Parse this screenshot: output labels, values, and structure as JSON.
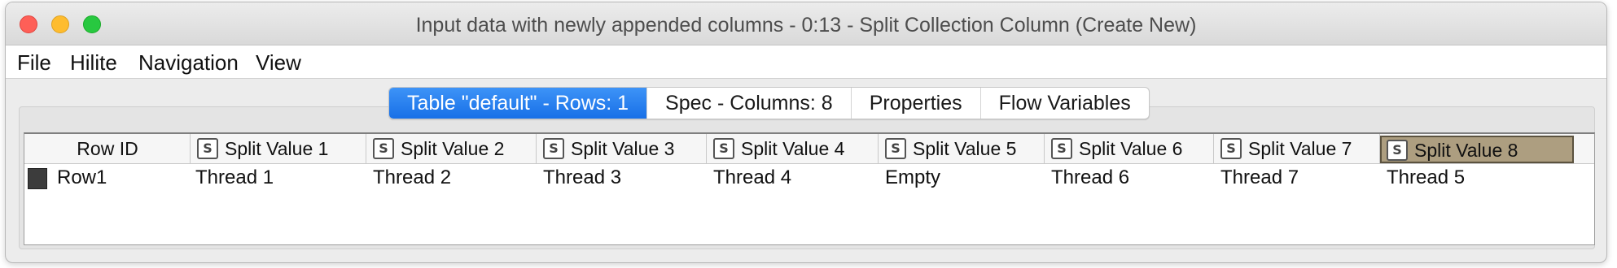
{
  "window": {
    "title": "Input data with newly appended columns - 0:13 - Split Collection Column (Create New)"
  },
  "menu": {
    "items": [
      "File",
      "Hilite",
      "Navigation",
      "View"
    ]
  },
  "tabs": [
    {
      "label": "Table \"default\" - Rows: 1",
      "active": true
    },
    {
      "label": "Spec - Columns: 8",
      "active": false
    },
    {
      "label": "Properties",
      "active": false
    },
    {
      "label": "Flow Variables",
      "active": false
    }
  ],
  "table": {
    "rowid_header": "Row ID",
    "columns": [
      {
        "type_badge": "S",
        "name": "Split Value 1"
      },
      {
        "type_badge": "S",
        "name": "Split Value 2"
      },
      {
        "type_badge": "S",
        "name": "Split Value 3"
      },
      {
        "type_badge": "S",
        "name": "Split Value 4"
      },
      {
        "type_badge": "S",
        "name": "Split Value 5"
      },
      {
        "type_badge": "S",
        "name": "Split Value 6"
      },
      {
        "type_badge": "S",
        "name": "Split Value 7"
      },
      {
        "type_badge": "S",
        "name": "Split Value 8",
        "selected": true
      }
    ],
    "rows": [
      {
        "row_id": "Row1",
        "cells": [
          "Thread 1",
          "Thread 2",
          "Thread 3",
          "Thread 4",
          "Empty",
          "Thread 6",
          "Thread 7",
          "Thread 5"
        ]
      }
    ]
  },
  "colors": {
    "active_tab": "#1870e7",
    "selected_header": "#ad9e80",
    "traffic_close": "#fe5f57",
    "traffic_minimize": "#febc2e",
    "traffic_zoom": "#28c840"
  }
}
